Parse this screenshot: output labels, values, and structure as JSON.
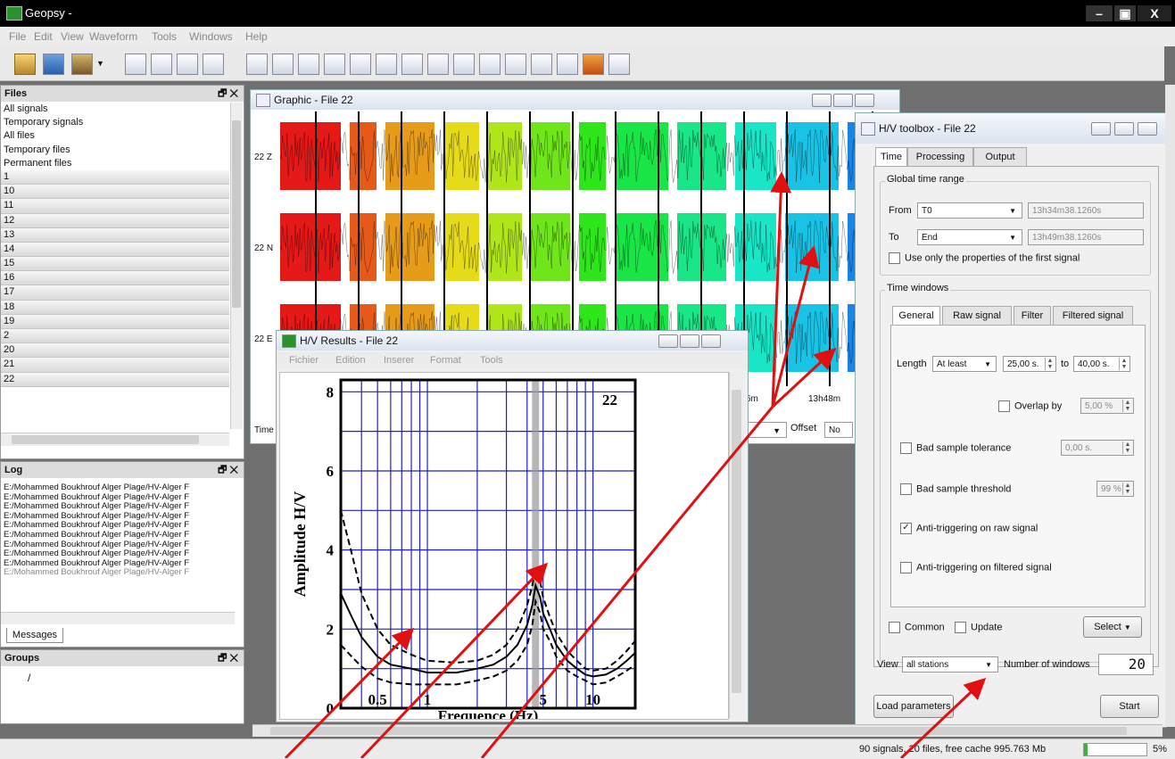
{
  "window": {
    "title": "Geopsy -"
  },
  "menu": [
    "File",
    "Edit",
    "View",
    "Waveform",
    "Tools",
    "Windows",
    "Help"
  ],
  "files_panel": {
    "title": "Files",
    "items": [
      "All signals",
      "Temporary signals",
      "All files",
      "Temporary files",
      "Permanent files"
    ],
    "numbers": [
      "1",
      "10",
      "11",
      "12",
      "13",
      "14",
      "15",
      "16",
      "17",
      "18",
      "19",
      "2",
      "20",
      "21",
      "22"
    ]
  },
  "log_panel": {
    "title": "Log",
    "lines": [
      "E:/Mohammed Boukhrouf Alger Plage/HV-Alger F",
      "E:/Mohammed Boukhrouf Alger Plage/HV-Alger F",
      "E:/Mohammed Boukhrouf Alger Plage/HV-Alger F",
      "E:/Mohammed Boukhrouf Alger Plage/HV-Alger F",
      "E:/Mohammed Boukhrouf Alger Plage/HV-Alger F",
      "E:/Mohammed Boukhrouf Alger Plage/HV-Alger F",
      "E:/Mohammed Boukhrouf Alger Plage/HV-Alger F",
      "E:/Mohammed Boukhrouf Alger Plage/HV-Alger F",
      "E:/Mohammed Boukhrouf Alger Plage/HV-Alger F",
      "E:/Mohammed Boukhrouf Alger Plage/HV-Alger F"
    ],
    "tab": "Messages"
  },
  "groups_panel": {
    "title": "Groups",
    "item": "/"
  },
  "graphic_window": {
    "title": "Graphic - File 22",
    "channels": [
      "22 Z",
      "22 N",
      "22 E"
    ],
    "time_labels": [
      "6m",
      "13h48m"
    ],
    "bottom_left": "Time",
    "offset_label": "Offset",
    "offset_value": "No"
  },
  "results_window": {
    "title": "H/V Results - File 22",
    "menu": [
      "Fichier",
      "Edition",
      "Inserer",
      "Format",
      "Tools"
    ]
  },
  "chart_data": {
    "type": "line",
    "title": "",
    "annotation": "22",
    "xlabel": "Frequence (Hz)",
    "ylabel": "Amplitude H/V",
    "xscale": "log",
    "xlim": [
      0.3,
      18
    ],
    "ylim": [
      0,
      8.3
    ],
    "xticks": [
      "0.5",
      "1",
      "5",
      "10"
    ],
    "yticks": [
      "0",
      "2",
      "4",
      "6",
      "8"
    ],
    "peak_frequency": 4.5,
    "x": [
      0.3,
      0.35,
      0.4,
      0.5,
      0.6,
      0.8,
      1.0,
      1.5,
      2.0,
      2.5,
      3.0,
      3.5,
      4.0,
      4.3,
      4.5,
      4.8,
      5.0,
      5.5,
      6.0,
      7.0,
      8.0,
      9.0,
      10.0,
      12.0,
      14.0,
      16.0,
      18.0
    ],
    "series": [
      {
        "name": "",
        "style": "solid",
        "values": [
          2.9,
          2.3,
          1.8,
          1.3,
          1.1,
          1.0,
          0.9,
          0.9,
          1.0,
          1.1,
          1.3,
          1.6,
          2.1,
          2.6,
          3.1,
          2.8,
          2.4,
          2.0,
          1.6,
          1.2,
          1.0,
          0.85,
          0.8,
          0.85,
          1.0,
          1.2,
          1.4
        ]
      },
      {
        "name": "",
        "style": "dashed",
        "values": [
          5.0,
          3.9,
          2.9,
          2.0,
          1.6,
          1.35,
          1.2,
          1.15,
          1.2,
          1.35,
          1.6,
          2.0,
          2.6,
          3.1,
          3.5,
          3.2,
          2.8,
          2.3,
          1.9,
          1.45,
          1.2,
          1.0,
          0.95,
          1.0,
          1.2,
          1.45,
          1.7
        ]
      },
      {
        "name": "",
        "style": "dashed",
        "values": [
          1.6,
          1.3,
          1.05,
          0.75,
          0.65,
          0.6,
          0.6,
          0.6,
          0.7,
          0.8,
          0.95,
          1.2,
          1.6,
          2.1,
          2.7,
          2.4,
          2.0,
          1.7,
          1.3,
          0.95,
          0.8,
          0.7,
          0.6,
          0.65,
          0.8,
          0.95,
          1.1
        ]
      }
    ]
  },
  "toolbox": {
    "title": "H/V toolbox - File 22",
    "tabs": [
      "Time",
      "Processing",
      "Output"
    ],
    "global_time_range": "Global time range",
    "from_label": "From",
    "from_value": "T0",
    "from_time": "13h34m38.1260s",
    "to_label": "To",
    "to_value": "End",
    "to_time": "13h49m38.1260s",
    "first_signal_label": "Use only the properties of the first signal",
    "time_windows": "Time windows",
    "subtabs": [
      "General",
      "Raw signal",
      "Filter",
      "Filtered signal"
    ],
    "length_label": "Length",
    "length_mode": "At least",
    "length_min": "25,00 s.",
    "to_word": "to",
    "length_max": "40,00 s.",
    "overlap_label": "Overlap by",
    "overlap_value": "5,00 %",
    "bad_tolerance_label": "Bad sample tolerance",
    "bad_tolerance_value": "0,00 s.",
    "bad_threshold_label": "Bad sample threshold",
    "bad_threshold_value": "99 %",
    "anti_raw_label": "Anti-triggering on raw signal",
    "anti_filtered_label": "Anti-triggering on filtered signal",
    "common_label": "Common",
    "update_label": "Update",
    "select_label": "Select",
    "view_label": "View",
    "view_value": "all stations",
    "nwin_label": "Number of windows",
    "nwin_value": "20",
    "load_label": "Load parameters",
    "start_label": "Start"
  },
  "status": {
    "text": "90 signals, 20 files, free cache 995.763 Mb",
    "percent": "5%",
    "progress": 0.05
  }
}
